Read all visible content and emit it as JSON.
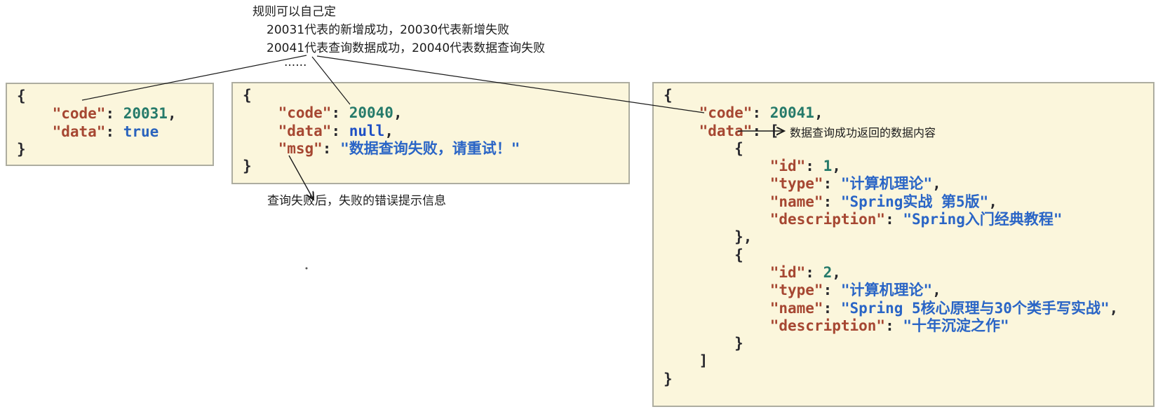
{
  "annotations": {
    "rule_title": "规则可以自己定",
    "rule_line1": "20031代表的新增成功，20030代表新增失败",
    "rule_line2": "20041代表查询数据成功，20040代表数据查询失败",
    "rule_ellipsis": "......",
    "msg_note": "查询失败后，失败的错误提示信息",
    "data_note": "数据查询成功返回的数据内容"
  },
  "colors": {
    "box_bg": "#fbf6dc",
    "box_border": "#adada0",
    "key": "#a64732",
    "number": "#257a6a",
    "string": "#2a65c6",
    "keyword": "#1f4fc5",
    "bool": "#2a63bd",
    "punct": "#28282e",
    "annotation": "#1c1c1c",
    "line": "#1a1a1a"
  },
  "boxes": [
    {
      "id": "left",
      "lines": [
        [
          [
            "p",
            "{"
          ]
        ],
        [
          [
            "p",
            "    "
          ],
          [
            "k",
            "\"code\""
          ],
          [
            "p",
            ": "
          ],
          [
            "n",
            "20031"
          ],
          [
            "p",
            ","
          ]
        ],
        [
          [
            "p",
            "    "
          ],
          [
            "k",
            "\"data\""
          ],
          [
            "p",
            ": "
          ],
          [
            "b",
            "true"
          ]
        ],
        [
          [
            "p",
            "}"
          ]
        ]
      ]
    },
    {
      "id": "middle",
      "lines": [
        [
          [
            "p",
            "{"
          ]
        ],
        [
          [
            "p",
            "    "
          ],
          [
            "k",
            "\"code\""
          ],
          [
            "p",
            ": "
          ],
          [
            "n",
            "20040"
          ],
          [
            "p",
            ","
          ]
        ],
        [
          [
            "p",
            "    "
          ],
          [
            "k",
            "\"data\""
          ],
          [
            "p",
            ": "
          ],
          [
            "u",
            "null"
          ],
          [
            "p",
            ","
          ]
        ],
        [
          [
            "p",
            "    "
          ],
          [
            "k",
            "\"msg\""
          ],
          [
            "p",
            ": "
          ],
          [
            "s",
            "\"数据查询失败，请重试！\""
          ]
        ],
        [
          [
            "p",
            "}"
          ]
        ]
      ]
    },
    {
      "id": "right",
      "lines": [
        [
          [
            "p",
            "{"
          ]
        ],
        [
          [
            "p",
            "    "
          ],
          [
            "k",
            "\"code\""
          ],
          [
            "p",
            ": "
          ],
          [
            "n",
            "20041"
          ],
          [
            "p",
            ","
          ]
        ],
        [
          [
            "p",
            "    "
          ],
          [
            "k",
            "\"data\""
          ],
          [
            "p",
            ": "
          ],
          [
            "p",
            "["
          ]
        ],
        [
          [
            "p",
            "        {"
          ]
        ],
        [
          [
            "p",
            "            "
          ],
          [
            "k",
            "\"id\""
          ],
          [
            "p",
            ": "
          ],
          [
            "n",
            "1"
          ],
          [
            "p",
            ","
          ]
        ],
        [
          [
            "p",
            "            "
          ],
          [
            "k",
            "\"type\""
          ],
          [
            "p",
            ": "
          ],
          [
            "s",
            "\"计算机理论\""
          ],
          [
            "p",
            ","
          ]
        ],
        [
          [
            "p",
            "            "
          ],
          [
            "k",
            "\"name\""
          ],
          [
            "p",
            ": "
          ],
          [
            "s",
            "\"Spring实战 第5版\""
          ],
          [
            "p",
            ","
          ]
        ],
        [
          [
            "p",
            "            "
          ],
          [
            "k",
            "\"description\""
          ],
          [
            "p",
            ": "
          ],
          [
            "s",
            "\"Spring入门经典教程\""
          ]
        ],
        [
          [
            "p",
            "        },"
          ]
        ],
        [
          [
            "p",
            "        {"
          ]
        ],
        [
          [
            "p",
            "            "
          ],
          [
            "k",
            "\"id\""
          ],
          [
            "p",
            ": "
          ],
          [
            "n",
            "2"
          ],
          [
            "p",
            ","
          ]
        ],
        [
          [
            "p",
            "            "
          ],
          [
            "k",
            "\"type\""
          ],
          [
            "p",
            ": "
          ],
          [
            "s",
            "\"计算机理论\""
          ],
          [
            "p",
            ","
          ]
        ],
        [
          [
            "p",
            "            "
          ],
          [
            "k",
            "\"name\""
          ],
          [
            "p",
            ": "
          ],
          [
            "s",
            "\"Spring 5核心原理与30个类手写实战\""
          ],
          [
            "p",
            ","
          ]
        ],
        [
          [
            "p",
            "            "
          ],
          [
            "k",
            "\"description\""
          ],
          [
            "p",
            ": "
          ],
          [
            "s",
            "\"十年沉淀之作\""
          ]
        ],
        [
          [
            "p",
            "        }"
          ]
        ],
        [
          [
            "p",
            "    ]"
          ]
        ],
        [
          [
            "p",
            "}"
          ]
        ]
      ]
    }
  ]
}
